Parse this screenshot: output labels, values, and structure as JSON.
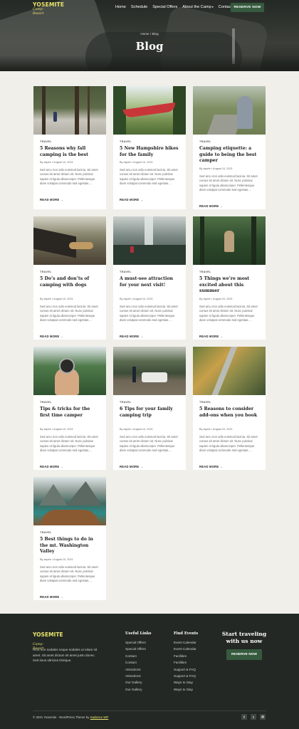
{
  "header": {
    "logo_line1": "YOSEMITE",
    "logo_line2": "Camp · Resort",
    "menu": [
      {
        "label": "Home"
      },
      {
        "label": "Schedule"
      },
      {
        "label": "Special Offers"
      },
      {
        "label": "About the Camp"
      },
      {
        "label": "Contact"
      }
    ],
    "reserve_label": "RESERVE NOW",
    "breadcrumb": "Home / Blog",
    "title": "Blog"
  },
  "posts": [
    {
      "category": "TRAVEL",
      "title": "5 Reasons why fall camping is the best",
      "meta": "By aspire  •  August 10, 2021",
      "excerpt": "Sed arcu non odio euismod lacinia. Sit amet cursus sit amet dictum sit. Nunc pulvinar sapien et ligula ullamcorper. Pellentesque diam volutpat commodo sed egestas....",
      "read_more": "READ MORE →"
    },
    {
      "category": "TRAVEL",
      "title": "5 New Hampshire hikes for the family",
      "meta": "By aspire  •  August 10, 2021",
      "excerpt": "Sed arcu non odio euismod lacinia. Sit amet cursus sit amet dictum sit. Nunc pulvinar sapien et ligula ullamcorper. Pellentesque diam volutpat commodo sed egestas....",
      "read_more": "READ MORE →"
    },
    {
      "category": "TRAVEL",
      "title": "Camping etiquette: a guide to being the best camper",
      "meta": "By aspire  •  August 10, 2021",
      "excerpt": "Sed arcu non odio euismod lacinia. Sit amet cursus sit amet dictum sit. Nunc pulvinar sapien et ligula ullamcorper. Pellentesque diam volutpat commodo sed egestas....",
      "read_more": "READ MORE →"
    },
    {
      "category": "TRAVEL",
      "title": "5 Do’s and don’ts of camping with dogs",
      "meta": "By aspire  •  August 10, 2021",
      "excerpt": "Sed arcu non odio euismod lacinia. Sit amet cursus sit amet dictum sit. Nunc pulvinar sapien et ligula ullamcorper. Pellentesque diam volutpat commodo sed egestas....",
      "read_more": "READ MORE →"
    },
    {
      "category": "TRAVEL",
      "title": "A must-see attraction for your next visit!",
      "meta": "By aspire  •  August 10, 2021",
      "excerpt": "Sed arcu non odio euismod lacinia. Sit amet cursus sit amet dictum sit. Nunc pulvinar sapien et ligula ullamcorper. Pellentesque diam volutpat commodo sed egestas....",
      "read_more": "READ MORE →"
    },
    {
      "category": "TRAVEL",
      "title": "5 Things we’re most excited about this summer",
      "meta": "By aspire  •  August 10, 2021",
      "excerpt": "Sed arcu non odio euismod lacinia. Sit amet cursus sit amet dictum sit. Nunc pulvinar sapien et ligula ullamcorper. Pellentesque diam volutpat commodo sed egestas....",
      "read_more": "READ MORE →"
    },
    {
      "category": "TRAVEL",
      "title": "Tips & tricks for the first time camper",
      "meta": "By aspire  •  August 10, 2021",
      "excerpt": "Sed arcu non odio euismod lacinia. Sit amet cursus sit amet dictum sit. Nunc pulvinar sapien et ligula ullamcorper. Pellentesque diam volutpat commodo sed egestas....",
      "read_more": "READ MORE →"
    },
    {
      "category": "TRAVEL",
      "title": "6 Tips for your family camping trip",
      "meta": "By aspire  •  August 10, 2021",
      "excerpt": "Sed arcu non odio euismod lacinia. Sit amet cursus sit amet dictum sit. Nunc pulvinar sapien et ligula ullamcorper. Pellentesque diam volutpat commodo sed egestas....",
      "read_more": "READ MORE →"
    },
    {
      "category": "TRAVEL",
      "title": "5 Reasons to consider add-ons when you book",
      "meta": "By aspire  •  August 10, 2021",
      "excerpt": "Sed arcu non odio euismod lacinia. Sit amet cursus sit amet dictum sit. Nunc pulvinar sapien et ligula ullamcorper. Pellentesque diam volutpat commodo sed egestas....",
      "read_more": "READ MORE →"
    },
    {
      "category": "TRAVEL",
      "title": "5 Best things to do in the mt. Washington Valley",
      "meta": "By aspire  •  August 10, 2021",
      "excerpt": "Sed arcu non odio euismod lacinia. Sit amet cursus sit amet dictum sit. Nunc pulvinar sapien et ligula ullamcorper. Pellentesque diam volutpat commodo sed egestas....",
      "read_more": "READ MORE →"
    }
  ],
  "footer": {
    "description": "Arcu non sodales neque sodales ut etiam sit amet. Sit amet dictum sit amet justo donec. Sed risus ultricies tristique.",
    "useful_links_title": "Useful Links",
    "useful_links": [
      "Special Offers",
      "Special Offers",
      "Contact",
      "Contact",
      "Attractions",
      "Attractions",
      "Our Gallery",
      "Our Gallery"
    ],
    "find_events_title": "Find Events",
    "find_events": [
      "Event Calendar",
      "Event Calendar",
      "Facilities",
      "Facilities",
      "Support & FAQ",
      "Support & FAQ",
      "Ways to Stay",
      "Ways to Stay"
    ],
    "cta_title": "Start traveling with us now",
    "cta_button": "RESERVE NOW",
    "copyright": "© 2021 Yosemite - WordPress Theme by ",
    "copyright_link": "Kadence WP",
    "social": [
      {
        "icon": "facebook-icon",
        "glyph": "f"
      },
      {
        "icon": "twitter-icon",
        "glyph": "t"
      },
      {
        "icon": "instagram-icon",
        "glyph": "◎"
      }
    ]
  },
  "colors": {
    "accent": "#365a3e",
    "logo": "#e7e26a",
    "page_bg": "#f0efea",
    "footer_bg": "#232825"
  }
}
